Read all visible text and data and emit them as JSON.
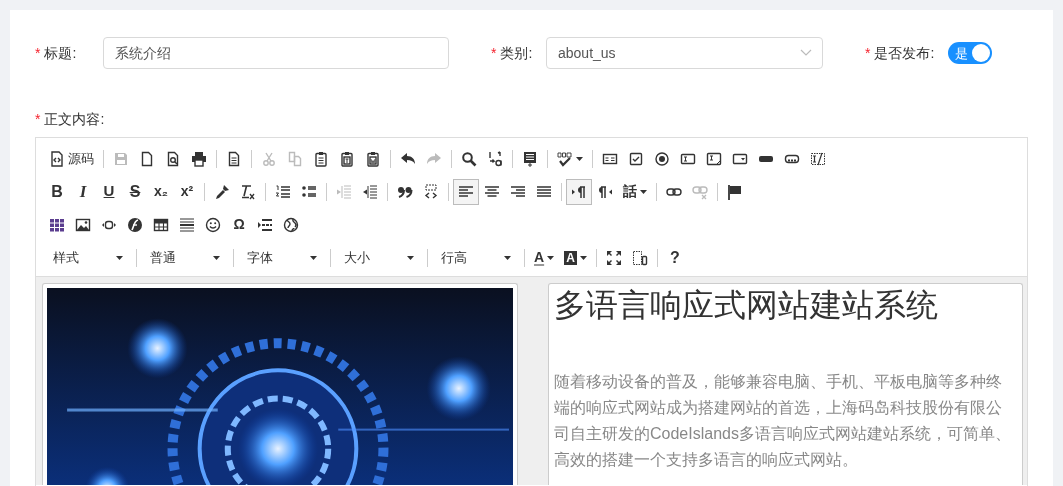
{
  "form": {
    "title": {
      "marker": "*",
      "label": "标题:",
      "value": "系统介绍"
    },
    "category": {
      "marker": "*",
      "label": "类别:",
      "value": "about_us"
    },
    "publish": {
      "marker": "*",
      "label": "是否发布:",
      "on": true,
      "on_text": "是"
    },
    "content": {
      "marker": "*",
      "label": "正文内容:"
    }
  },
  "toolbar": {
    "rows": [
      [
        [
          {
            "label": "源码",
            "disabled": false
          }
        ],
        [
          {
            "disabled": true
          },
          {
            "disabled": false
          },
          {
            "disabled": false
          },
          {
            "disabled": false
          }
        ],
        [
          {
            "disabled": false
          }
        ],
        [
          {
            "disabled": true
          },
          {
            "disabled": true
          },
          {
            "disabled": false
          },
          {
            "disabled": false
          },
          {
            "disabled": false
          }
        ],
        [
          {
            "disabled": false
          },
          {
            "disabled": true
          }
        ],
        [
          {
            "disabled": false
          },
          {
            "disabled": false
          }
        ],
        [
          {
            "disabled": false
          }
        ],
        [
          {
            "disabled": false,
            "dropdown": true
          }
        ],
        [
          {
            "disabled": false
          },
          {
            "disabled": false
          },
          {
            "disabled": false
          },
          {
            "disabled": false
          },
          {
            "disabled": false
          },
          {
            "disabled": false
          },
          {
            "disabled": false
          },
          {
            "disabled": false
          },
          {
            "disabled": false
          }
        ]
      ],
      [
        [
          {
            "glyph": "B",
            "kind": "bold"
          },
          {
            "glyph": "I",
            "kind": "italic"
          },
          {
            "glyph": "U",
            "kind": "underline"
          },
          {
            "glyph": "S",
            "kind": "strike"
          },
          {
            "glyph": "x₂",
            "kind": "plain"
          },
          {
            "glyph": "x²",
            "kind": "plain"
          }
        ],
        [
          {
            "disabled": false
          },
          {
            "disabled": false
          }
        ],
        [
          {
            "disabled": false
          },
          {
            "disabled": false
          }
        ],
        [
          {
            "disabled": true
          },
          {
            "disabled": false
          }
        ],
        [
          {
            "disabled": false
          },
          {
            "disabled": false
          }
        ],
        [
          {
            "disabled": false,
            "pressed": true
          },
          {
            "disabled": false,
            "pressed": false
          },
          {
            "disabled": false,
            "pressed": false
          },
          {
            "disabled": false,
            "pressed": false
          }
        ],
        [
          {
            "disabled": false,
            "pressed": true
          },
          {
            "disabled": false,
            "pressed": false
          },
          {
            "glyph": "話",
            "kind": "plain",
            "dropdown": true,
            "pressed": false
          }
        ],
        [
          {
            "disabled": false
          },
          {
            "disabled": true
          }
        ],
        [
          {
            "disabled": false
          }
        ]
      ],
      [
        [
          {
            "disabled": false
          },
          {
            "disabled": false
          },
          {
            "disabled": false
          },
          {
            "disabled": false
          },
          {
            "disabled": false
          },
          {
            "disabled": false
          },
          {
            "disabled": false
          },
          {
            "glyph": "Ω",
            "kind": "plain"
          },
          {
            "disabled": false
          },
          {
            "disabled": false
          }
        ]
      ],
      [
        [
          {
            "combo": "样式"
          }
        ],
        [
          {
            "combo": "普通"
          }
        ],
        [
          {
            "combo": "字体"
          }
        ],
        [
          {
            "combo": "大小"
          }
        ],
        [
          {
            "combo": "行高"
          }
        ],
        [
          {
            "glyph": "A",
            "kind": "textcolor",
            "dropdown": true
          },
          {
            "glyph": "A",
            "kind": "bgcolor",
            "dropdown": true
          }
        ],
        [
          {
            "disabled": false
          },
          {
            "disabled": false
          }
        ],
        [
          {
            "glyph": "?",
            "kind": "bold"
          }
        ]
      ]
    ]
  },
  "body": {
    "heading": "多语言响应式网站建站系统",
    "paragraph": "随着移动设备的普及，能够兼容电脑、手机、平板电脑等多种终端的响应式网站成为搭建网站的首选，上海码岛科技股份有限公司自主研发的CodeIslands多语言响应式网站建站系统，可简单、高效的搭建一个支持多语言的响应式网站。"
  }
}
